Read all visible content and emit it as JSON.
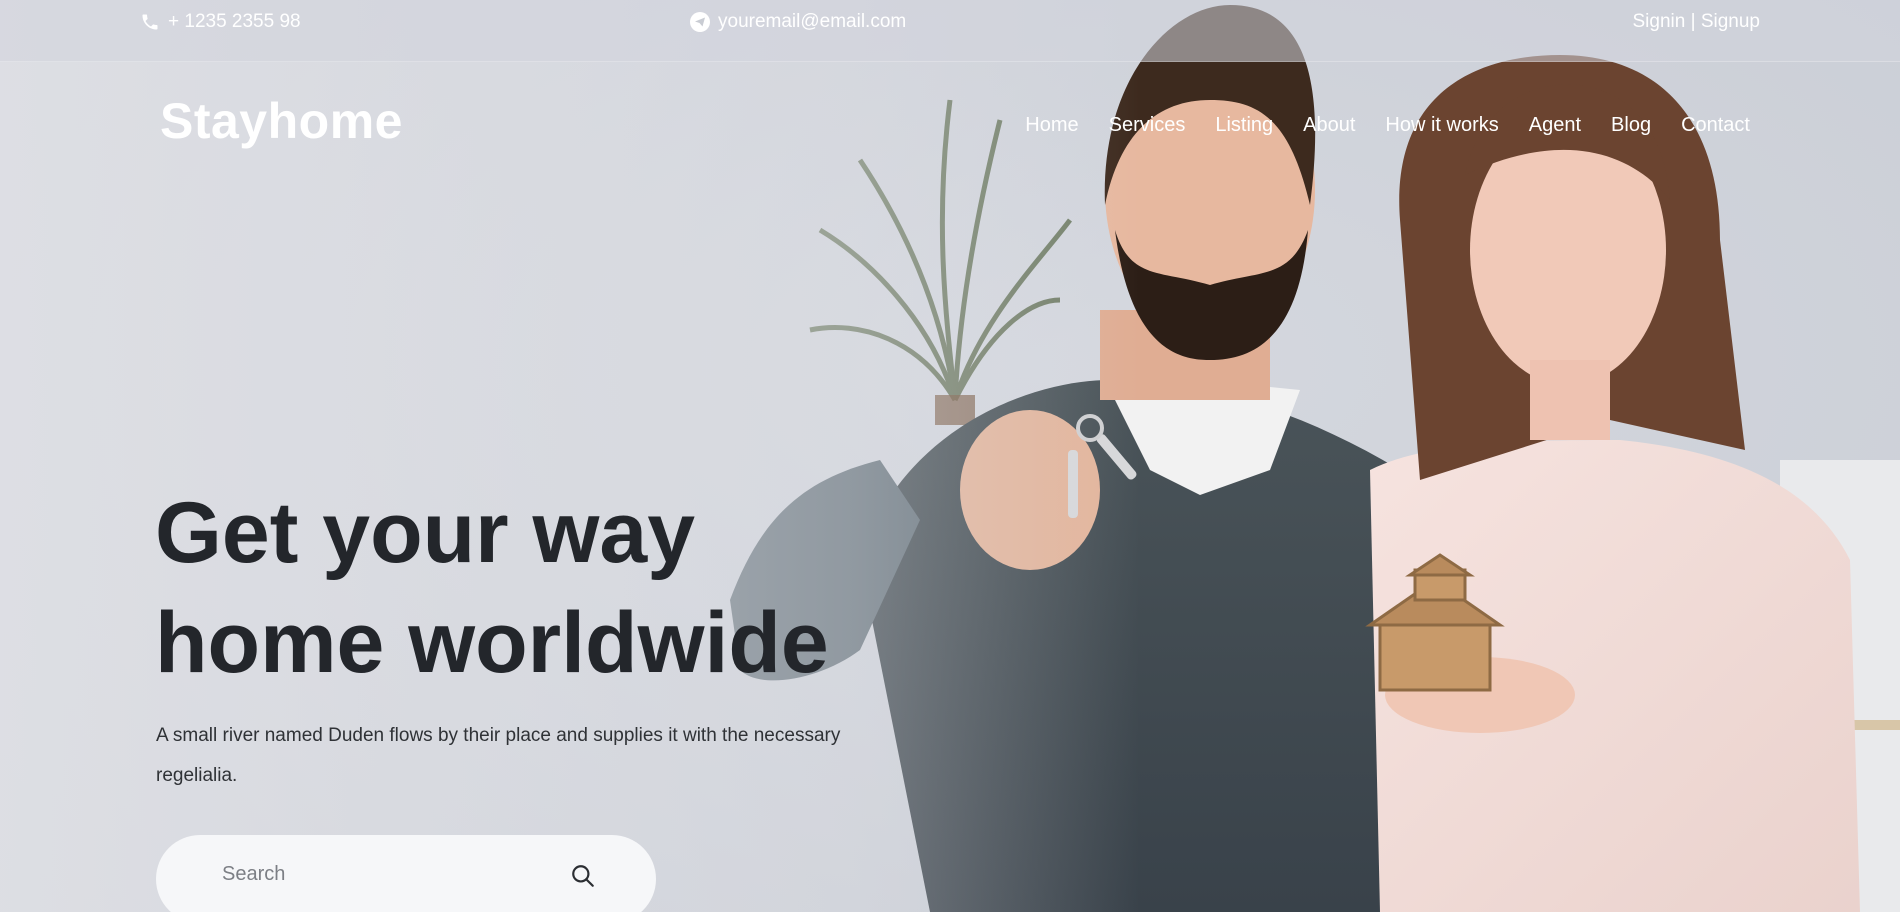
{
  "topbar": {
    "phone": "+ 1235 2355 98",
    "phone_icon": "phone-icon",
    "email": "youremail@email.com",
    "email_icon": "paper-plane-icon",
    "signin": "Signin",
    "separator": " | ",
    "signup": "Signup"
  },
  "brand": "Stayhome",
  "nav": {
    "items": [
      {
        "label": "Home"
      },
      {
        "label": "Services"
      },
      {
        "label": "Listing"
      },
      {
        "label": "About"
      },
      {
        "label": "How it works"
      },
      {
        "label": "Agent"
      },
      {
        "label": "Blog"
      },
      {
        "label": "Contact"
      }
    ]
  },
  "hero": {
    "headline_line1": "Get your way",
    "headline_line2": "home worldwide",
    "subtext": "A small river named Duden flows by their place and supplies it with the necessary regelialia."
  },
  "search": {
    "placeholder": "Search",
    "icon": "search-icon"
  },
  "colors": {
    "headline": "#23262b",
    "nav_text": "#ffffff",
    "search_bg": "#f6f7f9"
  }
}
